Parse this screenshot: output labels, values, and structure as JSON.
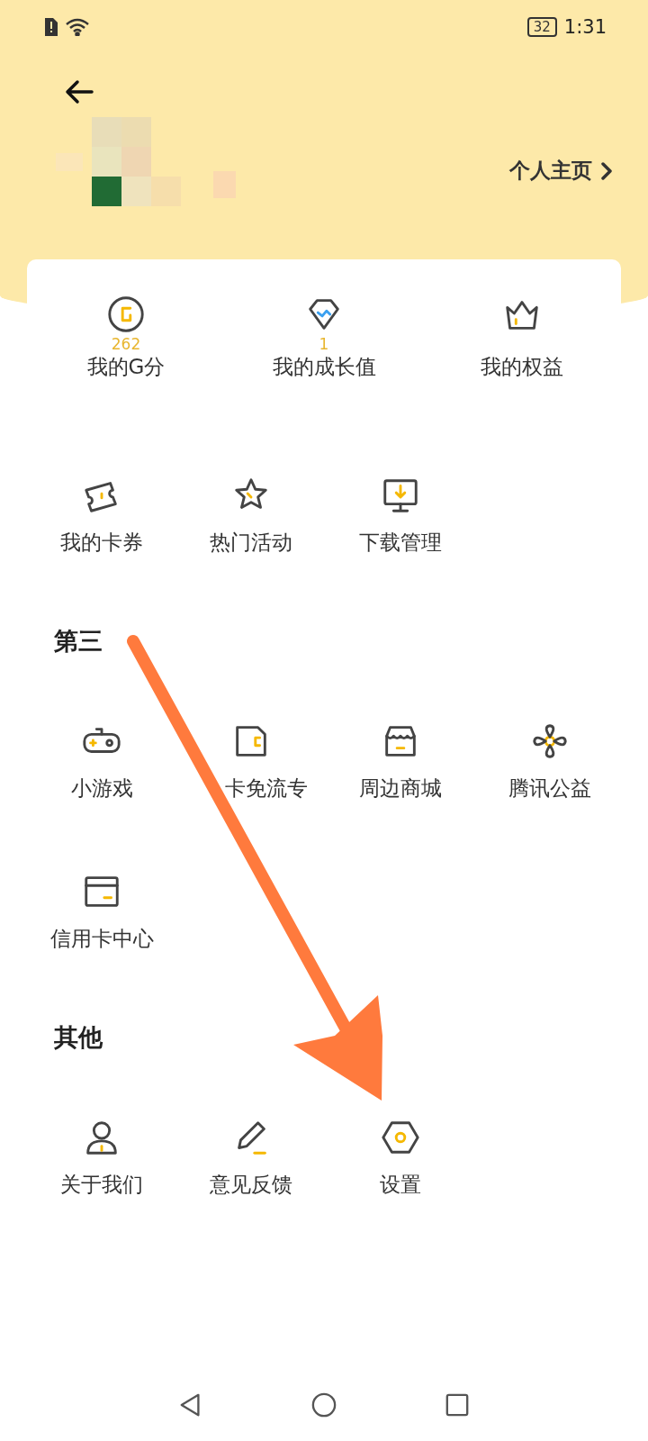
{
  "status_bar": {
    "battery": "32",
    "time": "1:31"
  },
  "header": {
    "profile_link": "个人主页"
  },
  "stats": [
    {
      "value": "262",
      "label": "我的G分"
    },
    {
      "value": "1",
      "label": "我的成长值"
    },
    {
      "label": "我的权益"
    }
  ],
  "quick_items": [
    {
      "label": "我的卡券"
    },
    {
      "label": "热门活动"
    },
    {
      "label": "下载管理"
    }
  ],
  "third_party": {
    "title": "第三",
    "items": [
      {
        "label": "小游戏"
      },
      {
        "label": "卡免流专"
      },
      {
        "label": "周边商城"
      },
      {
        "label": "腾讯公益"
      },
      {
        "label": "信用卡中心"
      }
    ]
  },
  "other": {
    "title": "其他",
    "items": [
      {
        "label": "关于我们"
      },
      {
        "label": "意见反馈"
      },
      {
        "label": "设置"
      }
    ]
  }
}
